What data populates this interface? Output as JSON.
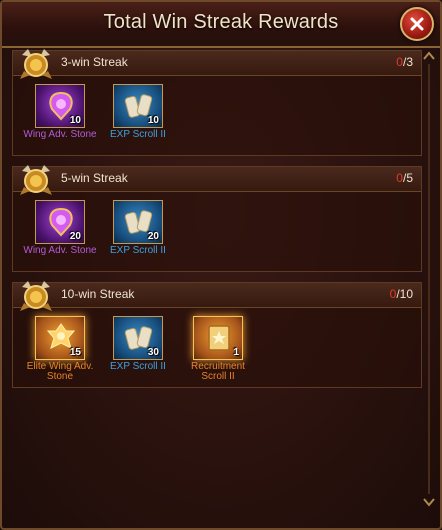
{
  "window": {
    "title": "Total Win Streak Rewards"
  },
  "sections": [
    {
      "title": "3-win Streak",
      "progress_current": "0",
      "progress_total": "/3",
      "items": [
        {
          "name": "Wing Adv. Stone",
          "qty": "10",
          "rarity": "purple",
          "icon": "wing-stone-icon"
        },
        {
          "name": "EXP Scroll II",
          "qty": "10",
          "rarity": "blue",
          "icon": "exp-scroll-icon"
        }
      ]
    },
    {
      "title": "5-win Streak",
      "progress_current": "0",
      "progress_total": "/5",
      "items": [
        {
          "name": "Wing Adv. Stone",
          "qty": "20",
          "rarity": "purple",
          "icon": "wing-stone-icon"
        },
        {
          "name": "EXP Scroll II",
          "qty": "20",
          "rarity": "blue",
          "icon": "exp-scroll-icon"
        }
      ]
    },
    {
      "title": "10-win Streak",
      "progress_current": "0",
      "progress_total": "/10",
      "items": [
        {
          "name": "Elite Wing Adv. Stone",
          "qty": "15",
          "rarity": "orange",
          "icon": "elite-wing-stone-icon"
        },
        {
          "name": "EXP Scroll II",
          "qty": "30",
          "rarity": "blue",
          "icon": "exp-scroll-icon"
        },
        {
          "name": "Recruitment Scroll II",
          "qty": "1",
          "rarity": "orange",
          "icon": "recruitment-scroll-icon"
        }
      ]
    }
  ],
  "colors": {
    "progress_current": "#e23a2a",
    "purple": "#b55bd6",
    "blue": "#3ba2e0",
    "orange": "#e8822a"
  }
}
